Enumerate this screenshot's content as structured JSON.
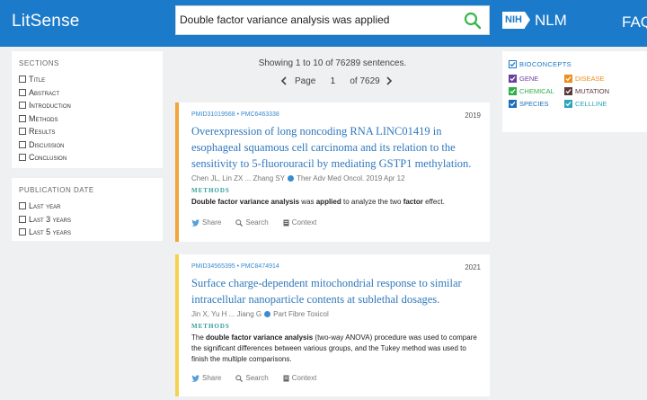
{
  "header": {
    "logo": "LitSense",
    "search_value": "Double factor variance analysis was applied",
    "nih": "NIH",
    "nlm": "NLM",
    "faq": "FAQ"
  },
  "sections_filter": {
    "title": "SECTIONS",
    "items": [
      "Title",
      "Abstract",
      "Introduction",
      "Methods",
      "Results",
      "Discussion",
      "Conclusion"
    ]
  },
  "pubdate_filter": {
    "title": "PUBLICATION DATE",
    "items": [
      "Last year",
      "Last 3 years",
      "Last 5 years"
    ]
  },
  "results": {
    "showing": "Showing 1 to 10 of 76289 sentences.",
    "page_label": "Page",
    "page_value": "1",
    "page_total": "of 7629"
  },
  "cards": [
    {
      "ids": "PMID31019568 • PMC6463338",
      "year": "2019",
      "title": "Overexpression of long noncoding RNA LINC01419 in esophageal squamous cell carcinoma and its relation to the sensitivity to 5-fluorouracil by mediating GSTP1 methylation.",
      "authors": "Chen JL, Lin ZX ... Zhang SY",
      "journal": "Ther Adv Med Oncol. 2019 Apr 12",
      "section": "METHODS",
      "snippet_parts": [
        "Double factor variance analysis",
        " was ",
        "applied",
        " to analyze the two ",
        "factor",
        " effect."
      ],
      "share": "Share",
      "search": "Search",
      "context": "Context",
      "accent": "#f3a43b"
    },
    {
      "ids": "PMID34565395 • PMC8474914",
      "year": "2021",
      "title": "Surface charge-dependent mitochondrial response to similar intracellular nanoparticle contents at sublethal dosages.",
      "authors": "Jin X, Yu H ... Jiang G",
      "journal": "Part Fibre Toxicol",
      "section": "METHODS",
      "snippet_parts": [
        "The ",
        "double factor variance analysis",
        " (two-way ANOVA) procedure was used to compare the significant differences between various groups, and the Tukey method was used to finish the multiple comparisons."
      ],
      "share": "Share",
      "search": "Search",
      "context": "Context",
      "accent": "#f6d24c"
    }
  ],
  "bioconcepts": {
    "title": "BIOCONCEPTS",
    "items": [
      {
        "label": "GENE",
        "color": "#6b3fa0"
      },
      {
        "label": "DISEASE",
        "color": "#f08c1b"
      },
      {
        "label": "CHEMICAL",
        "color": "#2fae4a"
      },
      {
        "label": "MUTATION",
        "color": "#5b3a3a"
      },
      {
        "label": "SPECIES",
        "color": "#1b6fb8"
      },
      {
        "label": "CELLLINE",
        "color": "#2aa6b8"
      }
    ]
  }
}
